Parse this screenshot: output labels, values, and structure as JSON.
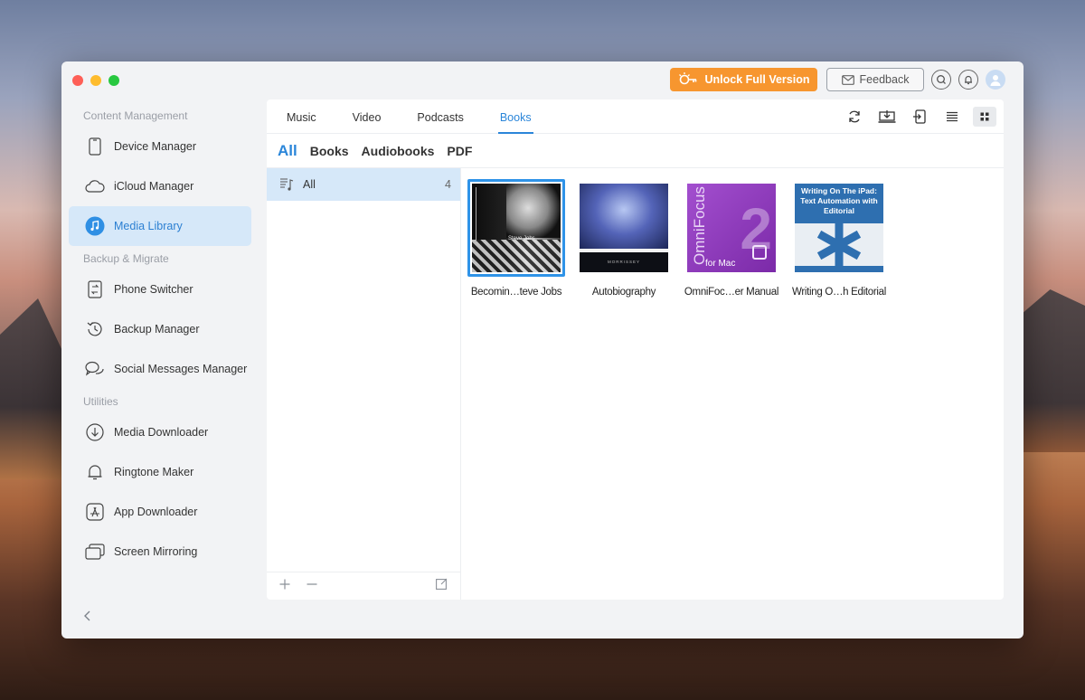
{
  "window": {
    "topbar": {
      "unlock_label": "Unlock Full Version",
      "feedback_label": "Feedback"
    }
  },
  "sidebar": {
    "sections": [
      {
        "label": "Content Management",
        "items": [
          {
            "label": "Device Manager",
            "icon": "phone-icon"
          },
          {
            "label": "iCloud Manager",
            "icon": "cloud-icon"
          },
          {
            "label": "Media Library",
            "icon": "music-note-icon",
            "active": true
          }
        ]
      },
      {
        "label": "Backup & Migrate",
        "items": [
          {
            "label": "Phone Switcher",
            "icon": "phone-switch-icon"
          },
          {
            "label": "Backup Manager",
            "icon": "history-icon"
          },
          {
            "label": "Social Messages Manager",
            "icon": "chat-bubbles-icon"
          }
        ]
      },
      {
        "label": "Utilities",
        "items": [
          {
            "label": "Media Downloader",
            "icon": "download-icon"
          },
          {
            "label": "Ringtone Maker",
            "icon": "bell-icon"
          },
          {
            "label": "App Downloader",
            "icon": "app-store-icon"
          },
          {
            "label": "Screen Mirroring",
            "icon": "screens-icon"
          }
        ]
      }
    ]
  },
  "main": {
    "tabs": [
      "Music",
      "Video",
      "Podcasts",
      "Books"
    ],
    "active_tab": "Books",
    "subtabs": [
      "All",
      "Books",
      "Audiobooks",
      "PDF"
    ],
    "active_subtab": "All",
    "list": {
      "label": "All",
      "count": "4"
    },
    "books": [
      {
        "title": "Becomin…teve Jobs",
        "cover_name": "Steve Jobs",
        "selected": true
      },
      {
        "title": "Autobiography",
        "cover_name": "MORRISSEY"
      },
      {
        "title": "OmniFoc…er Manual",
        "cover_vertical": "OmniFocus",
        "cover_number": "2",
        "cover_sub": "for Mac"
      },
      {
        "title": "Writing O…h Editorial",
        "cover_heading": "Writing On The iPad: Text Automation with Editorial"
      }
    ]
  },
  "colors": {
    "accent": "#2b86d9",
    "unlock": "#f7962f",
    "selection": "#d6e8f9"
  }
}
